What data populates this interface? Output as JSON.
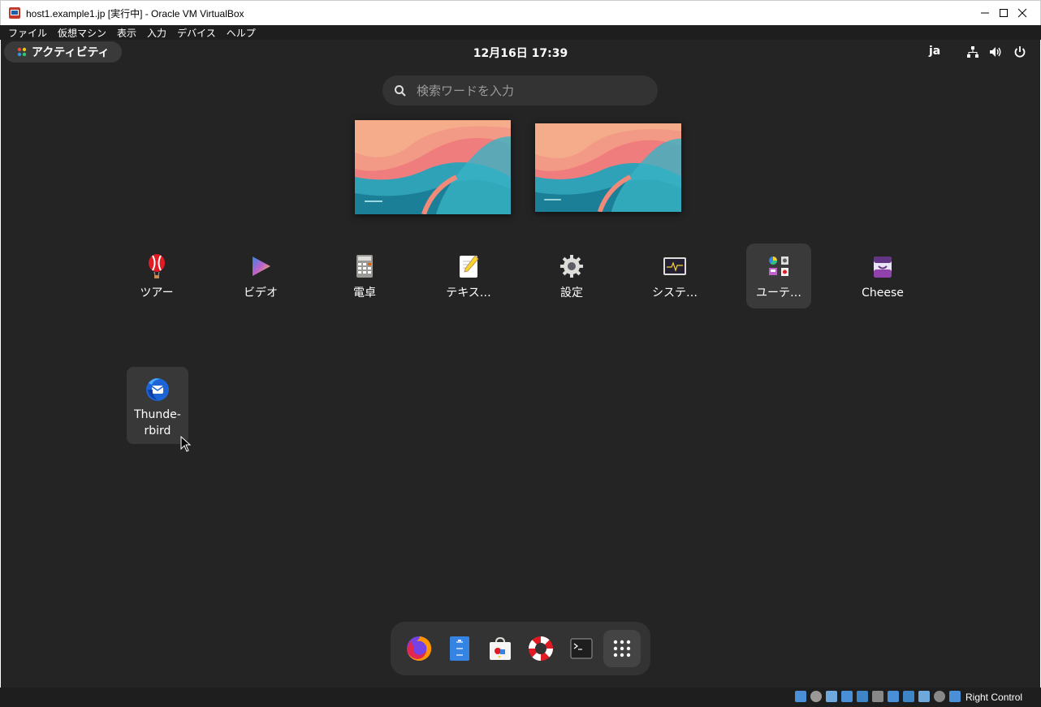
{
  "window": {
    "title": "host1.example1.jp [実行中] - Oracle VM VirtualBox"
  },
  "menubar": {
    "items": [
      "ファイル",
      "仮想マシン",
      "表示",
      "入力",
      "デバイス",
      "ヘルプ"
    ]
  },
  "topbar": {
    "activities_label": "アクティビティ",
    "clock": "12月16日  17:39",
    "language": "ja"
  },
  "search": {
    "placeholder": "検索ワードを入力"
  },
  "apps": [
    {
      "label": "ツアー",
      "icon": "balloon-icon"
    },
    {
      "label": "ビデオ",
      "icon": "video-player-icon"
    },
    {
      "label": "電卓",
      "icon": "calculator-icon"
    },
    {
      "label": "テキス…",
      "icon": "text-editor-icon"
    },
    {
      "label": "設定",
      "icon": "settings-gear-icon"
    },
    {
      "label": "システ…",
      "icon": "system-monitor-icon"
    },
    {
      "label": "ユーテ…",
      "icon": "utilities-folder-icon",
      "selected": true
    },
    {
      "label": "Cheese",
      "icon": "cheese-icon"
    }
  ],
  "folder_apps": [
    {
      "label": "Thunde-\nrbird",
      "icon": "thunderbird-icon"
    }
  ],
  "dock": [
    "firefox-icon",
    "files-icon",
    "software-icon",
    "help-icon",
    "terminal-icon",
    "app-grid-icon"
  ],
  "statusbar": {
    "host_key": "Right Control"
  },
  "colors": {
    "background": "#242424",
    "panel": "#333333",
    "selected": "#3a3a3a"
  }
}
